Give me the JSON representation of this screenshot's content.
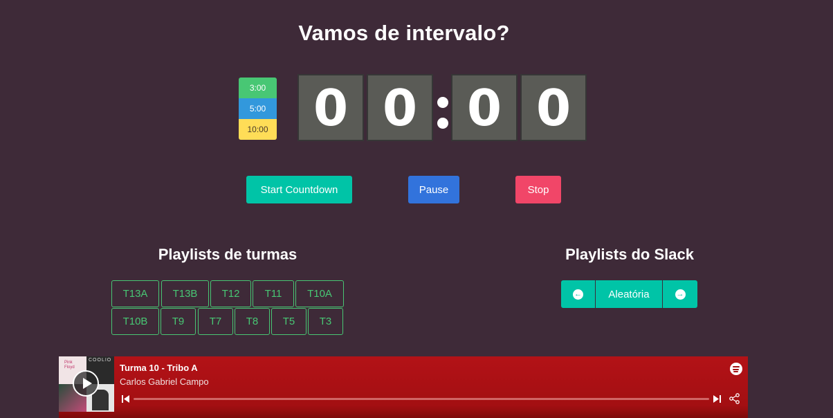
{
  "header": {
    "title": "Vamos de intervalo?"
  },
  "timer": {
    "presets": [
      "3:00",
      "5:00",
      "10:00"
    ],
    "digits": [
      "0",
      "0",
      "0",
      "0"
    ],
    "progress_fraction": 0
  },
  "controls": {
    "start": "Start Countdown",
    "pause": "Pause",
    "stop": "Stop"
  },
  "turmas": {
    "title": "Playlists de turmas",
    "row1": [
      "T13A",
      "T13B",
      "T12",
      "T11",
      "T10A"
    ],
    "row2": [
      "T10B",
      "T9",
      "T7",
      "T8",
      "T5",
      "T3"
    ]
  },
  "slack": {
    "title": "Playlists do Slack",
    "current": "Aleatória"
  },
  "player": {
    "track": "Turma 10 - Tribo A",
    "artist": "Carlos Gabriel Campo",
    "cover_text": "COOLIO",
    "progress": 0
  },
  "colors": {
    "background": "#3e2a38",
    "green": "#48c774",
    "blue": "#3298dc",
    "yellow": "#ffdd57",
    "primary": "#00c4a7",
    "link": "#3273dc",
    "danger": "#f14668",
    "player": "#b31217"
  }
}
